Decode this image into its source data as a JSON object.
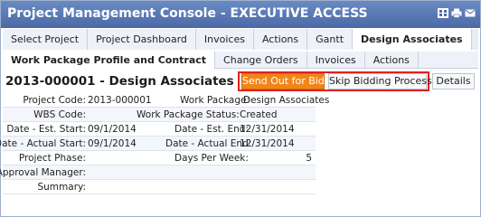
{
  "window": {
    "title": "Project Management Console - EXECUTIVE ACCESS",
    "icons": [
      "grid-icon",
      "print-icon",
      "mail-icon"
    ]
  },
  "primary_tabs": [
    {
      "label": "Select Project",
      "active": false
    },
    {
      "label": "Project Dashboard",
      "active": false
    },
    {
      "label": "Invoices",
      "active": false
    },
    {
      "label": "Actions",
      "active": false
    },
    {
      "label": "Gantt",
      "active": false
    },
    {
      "label": "Design Associates",
      "active": true
    }
  ],
  "secondary_tabs": [
    {
      "label": "Work Package Profile and Contract",
      "active": true
    },
    {
      "label": "Change Orders",
      "active": false
    },
    {
      "label": "Invoices",
      "active": false
    },
    {
      "label": "Actions",
      "active": false
    }
  ],
  "heading": "2013-000001 - Design Associates",
  "buttons": {
    "send_out": "Send Out for Bid",
    "skip": "Skip Bidding Process",
    "details": "Details"
  },
  "accent": {
    "title_bg": "#4b6aa6",
    "orange": "#f0861b",
    "highlight": "#e02020"
  },
  "fields": [
    {
      "label1": "Project Code:",
      "value1": "2013-000001",
      "label2": "Work Package:",
      "value2": "Design Associates"
    },
    {
      "label1": "WBS Code:",
      "value1": "",
      "label2": "Work Package Status:",
      "value2": "Created"
    },
    {
      "label1": "Date - Est. Start:",
      "value1": "09/1/2014",
      "label2": "Date - Est. End:",
      "value2": "12/31/2014"
    },
    {
      "label1": "Date - Actual Start:",
      "value1": "09/1/2014",
      "label2": "Date - Actual End:",
      "value2": "12/31/2014"
    },
    {
      "label1": "Project Phase:",
      "value1": "",
      "label2": "Days Per Week:",
      "value2": "5"
    },
    {
      "label1": "Approval Manager:",
      "value1": "",
      "label2": "",
      "value2": ""
    },
    {
      "label1": "Summary:",
      "value1": "",
      "label2": "",
      "value2": ""
    }
  ]
}
